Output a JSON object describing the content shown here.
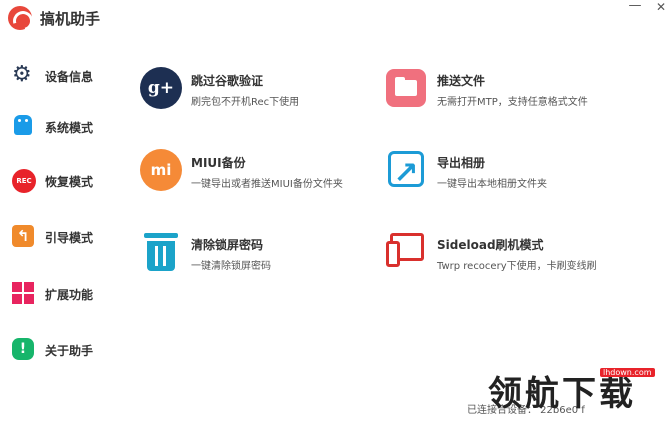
{
  "app": {
    "title": "搞机助手"
  },
  "window": {
    "minimize_glyph": "—",
    "close_glyph": "✕"
  },
  "sidebar": {
    "items": [
      {
        "label": "设备信息",
        "icon": "gear-icon"
      },
      {
        "label": "系统模式",
        "icon": "android-icon"
      },
      {
        "label": "恢复模式",
        "icon": "rec-icon",
        "icon_text": "REC"
      },
      {
        "label": "引导模式",
        "icon": "return-arrow-icon"
      },
      {
        "label": "扩展功能",
        "icon": "grid-icon"
      },
      {
        "label": "关于助手",
        "icon": "info-icon"
      }
    ]
  },
  "features": [
    {
      "title": "跳过谷歌验证",
      "desc": "刷完包不开机Rec下使用",
      "icon": "google-plus-icon",
      "icon_text": "g+"
    },
    {
      "title": "推送文件",
      "desc": "无需打开MTP，支持任意格式文件",
      "icon": "folder-icon"
    },
    {
      "title": "MIUI备份",
      "desc": "一键导出或者推送MIUI备份文件夹",
      "icon": "mi-icon",
      "icon_text": "mi"
    },
    {
      "title": "导出相册",
      "desc": "一键导出本地相册文件夹",
      "icon": "export-icon"
    },
    {
      "title": "清除锁屏密码",
      "desc": "一键清除锁屏密码",
      "icon": "trash-icon"
    },
    {
      "title": "Sideload刷机模式",
      "desc": "Twrp recocery下使用，卡刷变线刷",
      "icon": "devices-icon"
    }
  ],
  "status": {
    "text": "已连接合设备：    22b6e0 f"
  },
  "watermark": {
    "text": "领航下载",
    "url": "lhdown.com"
  },
  "colors": {
    "accent_red": "#e8473b",
    "google_navy": "#1d2f52",
    "folder_pink": "#f0707e",
    "mi_orange": "#f58a37",
    "export_blue": "#1c9bd6",
    "trash_teal": "#1ba3c9",
    "devices_red": "#d9302d"
  }
}
